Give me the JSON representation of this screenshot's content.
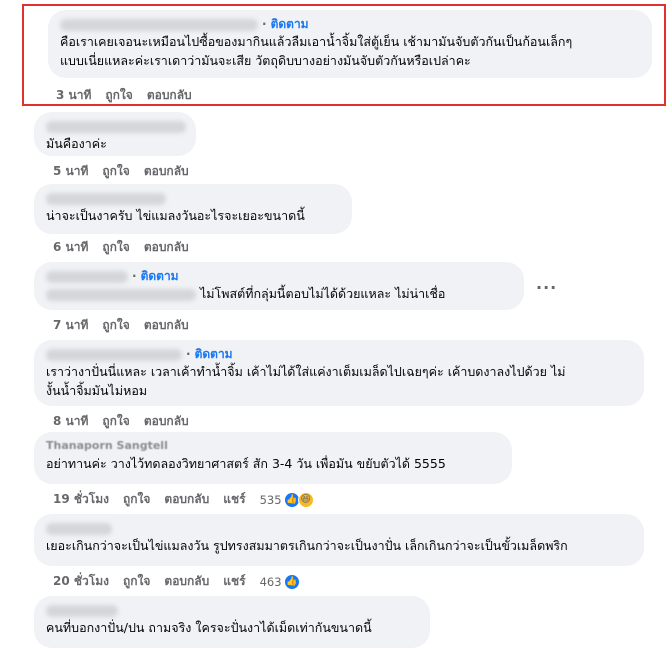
{
  "follow_label": "ติดตาม",
  "dot": "·",
  "more_label": "···",
  "actions": {
    "like": "ถูกใจ",
    "reply": "ตอบกลับ",
    "share": "แชร์"
  },
  "comments": [
    {
      "text": "คือเราเคยเจอนะเหมือนไปซื้อของมากินแล้วลืมเอาน้ำจิ้มใส่ตู้เย็น เช้ามามันจับตัวกันเป็นก้อนเล็กๆ\nแบบเนี่ยแหละค่ะเราเดาว่ามันจะเสีย วัตถุดิบบางอย่างมันจับตัวกันหรือเปล่าคะ",
      "time": "3 นาที"
    },
    {
      "text": "มันคืองาค่ะ",
      "time": "5 นาที"
    },
    {
      "text": "น่าจะเป็นงาครับ ไข่แมลงวันอะไรจะเยอะขนาดนี้",
      "time": "6 นาที"
    },
    {
      "text": "ไม่โพสต์ที่กลุ่มนี้ตอบไม่ได้ด้วยแหละ ไม่น่าเชื่อ",
      "time": "7 นาที"
    },
    {
      "text": "เราว่างาปั่นนี่แหละ เวลาเค้าทำน้ำจิ้ม เค้าไม่ได้ใส่แค่งาเต็มเมล็ดไปเฉยๆค่ะ เค้าบดงาลงไปด้วย ไม่\nงั้นน้ำจิ้มมันไม่หอม",
      "time": "8 นาที"
    },
    {
      "name": "Thanaporn Sangtell",
      "text": "อย่าทานค่ะ วางไว้ทดลองวิทยาศาสตร์ สัก 3-4 วัน เพื่อมัน ขยับตัวได้ 5555",
      "time": "19 ชั่วโมง",
      "reactions": "535"
    },
    {
      "text": "เยอะเกินกว่าจะเป็นไข่แมลงวัน รูปทรงสมมาตรเกินกว่าจะเป็นงาปั่น เล็กเกินกว่าจะเป็นขั้วเมล็ดพริก",
      "time": "20 ชั่วโมง",
      "reactions": "463"
    },
    {
      "text": "คนที่บอกงาปั่น/ปน ถามจริง ใครจะปั่นงาได้เม็ดเท่ากันขนาดนี้",
      "time": ""
    }
  ],
  "colors": {
    "highlight": "#e1312f",
    "link": "#1877f2",
    "bubble": "#f0f2f5",
    "meta": "#65676b"
  }
}
